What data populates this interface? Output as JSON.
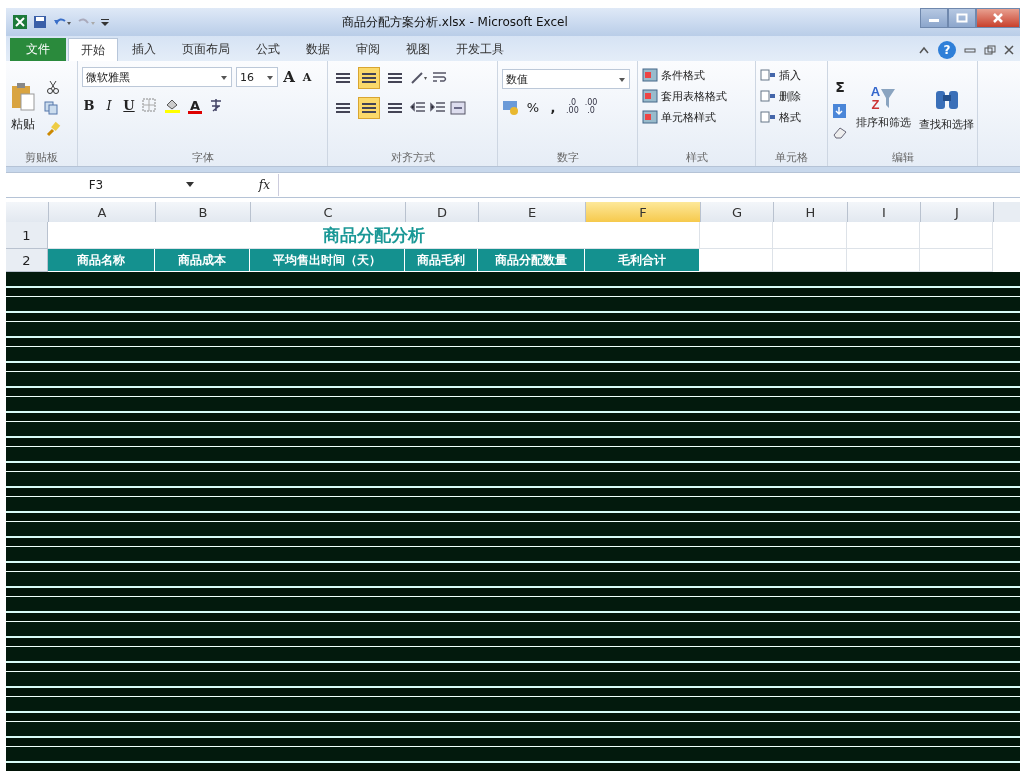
{
  "window": {
    "title": "商品分配方案分析.xlsx - Microsoft Excel",
    "help": "?"
  },
  "ribbon": {
    "tabs": [
      {
        "label": "文件",
        "kind": "file",
        "selected": false
      },
      {
        "label": "开始",
        "kind": "tab",
        "selected": true
      },
      {
        "label": "插入",
        "kind": "tab",
        "selected": false
      },
      {
        "label": "页面布局",
        "kind": "tab",
        "selected": false
      },
      {
        "label": "公式",
        "kind": "tab",
        "selected": false
      },
      {
        "label": "数据",
        "kind": "tab",
        "selected": false
      },
      {
        "label": "审阅",
        "kind": "tab",
        "selected": false
      },
      {
        "label": "视图",
        "kind": "tab",
        "selected": false
      },
      {
        "label": "开发工具",
        "kind": "tab",
        "selected": false
      }
    ],
    "clipboard": {
      "paste": "粘贴",
      "label": "剪贴板"
    },
    "font": {
      "name": "微软雅黑",
      "size": "16",
      "grow": "A",
      "shrink": "A",
      "bold": "B",
      "italic": "I",
      "underline": "U",
      "font_color": "A",
      "label": "字体"
    },
    "alignment": {
      "top_row": [
        {
          "on": false
        },
        {
          "on": true
        },
        {
          "on": false
        }
      ],
      "bottom_row": [
        {
          "on": false
        },
        {
          "on": true
        },
        {
          "on": false
        }
      ],
      "label": "对齐方式"
    },
    "number": {
      "format": "数值",
      "percent": "%",
      "comma": ",",
      "increase_decimal": [
        ".0",
        ".00"
      ],
      "decrease_decimal": [
        ".00",
        ".0"
      ],
      "label": "数字"
    },
    "styles": {
      "items": [
        "条件格式",
        "套用表格格式",
        "单元格样式"
      ],
      "label": "样式"
    },
    "cells": {
      "items": [
        "插入",
        "删除",
        "格式"
      ],
      "label": "单元格"
    },
    "editing": {
      "sum": "Σ",
      "sort_letters": [
        "A",
        "Z"
      ],
      "sort": "排序和筛选",
      "find": "查找和选择",
      "label": "编辑"
    }
  },
  "formula_bar": {
    "name_box": "F3",
    "fx": "fx"
  },
  "sheet": {
    "columns": [
      {
        "label": "A",
        "selected": false
      },
      {
        "label": "B",
        "selected": false
      },
      {
        "label": "C",
        "selected": false
      },
      {
        "label": "D",
        "selected": false
      },
      {
        "label": "E",
        "selected": false
      },
      {
        "label": "F",
        "selected": true
      },
      {
        "label": "G",
        "selected": false
      },
      {
        "label": "H",
        "selected": false
      },
      {
        "label": "I",
        "selected": false
      },
      {
        "label": "J",
        "selected": false
      }
    ],
    "rows": [
      "1",
      "2"
    ],
    "title": "商品分配分析",
    "headers": [
      "商品名称",
      "商品成本",
      "平均售出时间（天）",
      "商品毛利",
      "商品分配数量",
      "毛利合计"
    ]
  }
}
